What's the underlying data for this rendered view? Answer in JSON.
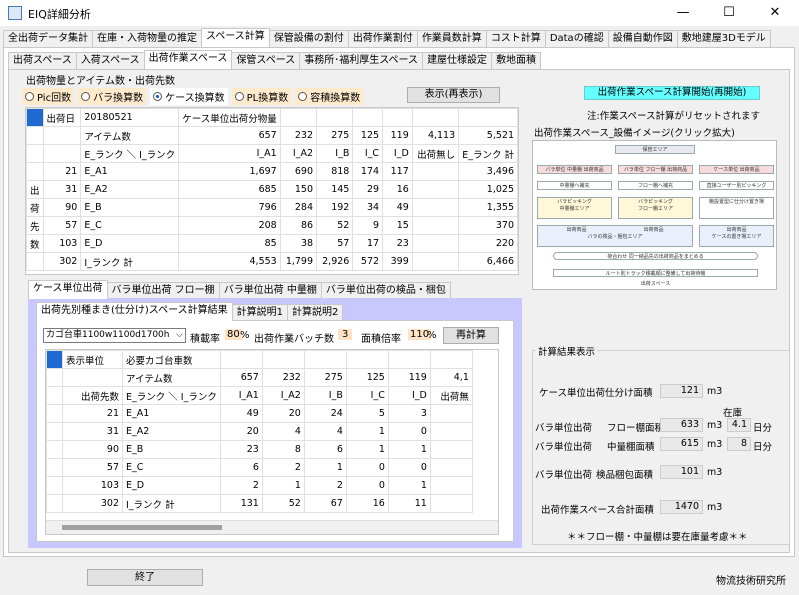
{
  "window": {
    "title": "EIQ詳細分析",
    "min": "—",
    "max": "☐",
    "close": "✕"
  },
  "main_tabs": [
    "全出荷データ集計",
    "在庫・入荷物量の推定",
    "スペース計算",
    "保管設備の割付",
    "出荷作業割付",
    "作業員数計算",
    "コスト計算",
    "Dataの確認",
    "設備自動作図",
    "敷地建屋3Dモデル"
  ],
  "main_tab_active": 2,
  "sub_tabs": [
    "出荷スペース",
    "入荷スペース",
    "出荷作業スペース",
    "保管スペース",
    "事務所･福利厚生スペース",
    "建屋仕様設定",
    "敷地面積"
  ],
  "sub_tab_active": 2,
  "group_label": "出荷物量とアイテム数・出荷先数",
  "radios": [
    {
      "label": "Pic回数",
      "on": false
    },
    {
      "label": "バラ換算数",
      "on": false
    },
    {
      "label": "ケース換算数",
      "on": true
    },
    {
      "label": "PL換算数",
      "on": false
    },
    {
      "label": "容積換算数",
      "on": false
    }
  ],
  "show_button": "表示(再表示)",
  "top_table": {
    "side_labels": [
      "出",
      "荷",
      "先",
      "数"
    ],
    "rows": [
      [
        "",
        "出荷日",
        "20180521",
        "ケース単位出荷分物量",
        "",
        "",
        "",
        "",
        "",
        ""
      ],
      [
        "",
        "",
        "アイテム数",
        "657",
        "232",
        "275",
        "125",
        "119",
        "4,113",
        "5,521"
      ],
      [
        "",
        "",
        "E_ランク ＼ I_ランク",
        "I_A1",
        "I_A2",
        "I_B",
        "I_C",
        "I_D",
        "出荷無し",
        "E_ランク 計"
      ],
      [
        "",
        "21",
        "E_A1",
        "1,697",
        "690",
        "818",
        "174",
        "117",
        "",
        "3,496"
      ],
      [
        "出",
        "31",
        "E_A2",
        "685",
        "150",
        "145",
        "29",
        "16",
        "",
        "1,025"
      ],
      [
        "荷",
        "90",
        "E_B",
        "796",
        "284",
        "192",
        "34",
        "49",
        "",
        "1,355"
      ],
      [
        "先",
        "57",
        "E_C",
        "208",
        "86",
        "52",
        "9",
        "15",
        "",
        "370"
      ],
      [
        "数",
        "103",
        "E_D",
        "85",
        "38",
        "57",
        "17",
        "23",
        "",
        "220"
      ],
      [
        "",
        "302",
        "I_ランク 計",
        "4,553",
        "1,799",
        "2,926",
        "572",
        "399",
        "",
        "6,466"
      ]
    ]
  },
  "lower_tabs": [
    "ケース単位出荷",
    "バラ単位出荷 フロー棚",
    "バラ単位出荷 中量棚",
    "バラ単位出荷の検品・梱包"
  ],
  "lower_tab_active": 0,
  "inner_tabs": [
    "出荷先別種まき(仕分け)スペース計算結果",
    "計算説明1",
    "計算説明2"
  ],
  "inner_tab_active": 0,
  "controls": {
    "cart_select": "カゴ台車1100w1100d1700h",
    "load_rate_label": "積載率",
    "load_rate": "80",
    "pct": "%",
    "batch_label": "出荷作業バッチ数",
    "batch": "3",
    "area_rate_label": "面積倍率",
    "area_rate": "110",
    "pct2": "%",
    "recalc": "再計算"
  },
  "lower_table": {
    "rows": [
      [
        "",
        "表示単位",
        "必要カゴ台車数",
        "",
        "",
        "",
        "",
        "",
        ""
      ],
      [
        "",
        "",
        "アイテム数",
        "657",
        "232",
        "275",
        "125",
        "119",
        "4,1"
      ],
      [
        "",
        "出荷先数",
        "E_ランク ＼ I_ランク",
        "I_A1",
        "I_A2",
        "I_B",
        "I_C",
        "I_D",
        "出荷無"
      ],
      [
        "",
        "21",
        "E_A1",
        "49",
        "20",
        "24",
        "5",
        "3",
        ""
      ],
      [
        "",
        "31",
        "E_A2",
        "20",
        "4",
        "4",
        "1",
        "0",
        ""
      ],
      [
        "",
        "90",
        "E_B",
        "23",
        "8",
        "6",
        "1",
        "1",
        ""
      ],
      [
        "",
        "57",
        "E_C",
        "6",
        "2",
        "1",
        "0",
        "0",
        ""
      ],
      [
        "",
        "103",
        "E_D",
        "2",
        "1",
        "2",
        "0",
        "1",
        ""
      ],
      [
        "",
        "302",
        "I_ランク 計",
        "131",
        "52",
        "67",
        "16",
        "11",
        ""
      ]
    ]
  },
  "right": {
    "start_button": "出荷作業スペース計算開始(再開始)",
    "note": "注:作業スペース計算がリセットされます",
    "diagram_title": "出荷作業スペース_設備イメージ(クリック拡大)",
    "diagram": {
      "top": "保管エリア",
      "b1": "バラ単位 中量棚 出荷商品",
      "b2": "バラ単位 フロー棚 出荷商品",
      "b3": "ケース単位 出荷商品",
      "c1": "中量棚へ補充",
      "c2": "フロー棚へ補充",
      "c3": "直接ユーザー別ピッキング",
      "d1": "バラピッキング",
      "d2": "バラピッキング",
      "e1": "中量棚エリア",
      "e2": "フロー棚エリア",
      "e3": "棚設置型に仕分け置き場",
      "f1": "出荷商品",
      "f2": "出荷商品",
      "f3": "出荷商品",
      "g1": "バラの検品・梱包エリア",
      "g2": "ケースの置き場エリア",
      "h": "荷合わせ 同一納品先の出荷商品をまとめる",
      "i": "ルート別トラック積載順に整備して出荷待機",
      "j": "出荷スペース"
    },
    "result_group": "計算結果表示",
    "results": {
      "case_label": "ケース単位出荷仕分け面積",
      "case_val": "121",
      "unit": "m3",
      "stock_label": "在庫",
      "flow_label1": "バラ単位出荷",
      "flow_label2": "フロー棚面積",
      "flow_val": "633",
      "flow_days": "4.1",
      "days_unit": "日分",
      "mid_label1": "バラ単位出荷",
      "mid_label2": "中量棚面積",
      "mid_val": "615",
      "mid_days": "8",
      "insp_label1": "バラ単位出荷",
      "insp_label2": "検品梱包面積",
      "insp_val": "101",
      "total_label": "出荷作業スペース合計面積",
      "total_val": "1470",
      "warning": "＊＊フロー棚・中量棚は要在庫量考慮＊＊"
    }
  },
  "footer": {
    "end_button": "終了",
    "company": "物流技術研究所"
  }
}
